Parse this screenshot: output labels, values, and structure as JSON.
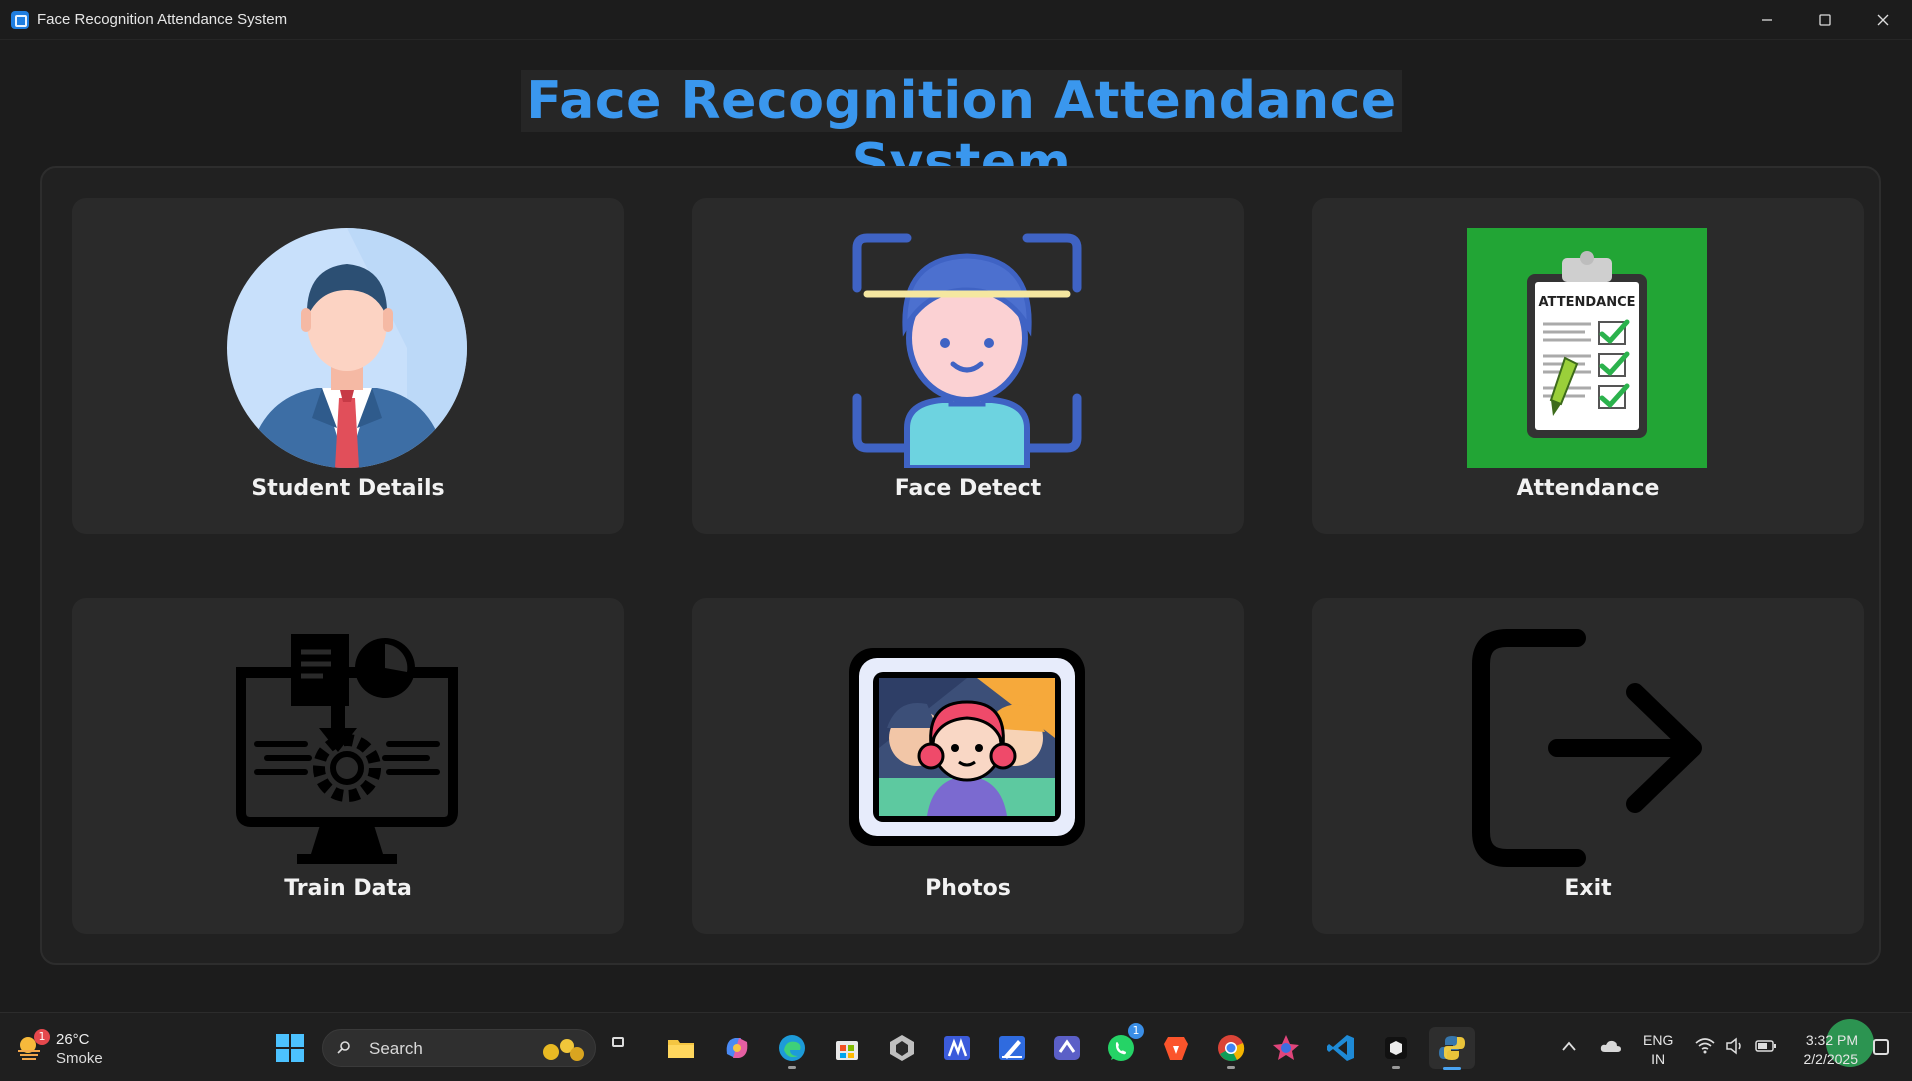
{
  "window": {
    "title": "Face Recognition Attendance System",
    "controls": [
      "minimize",
      "maximize",
      "close"
    ]
  },
  "heading": "Face Recognition Attendance System",
  "colors": {
    "heading": "#3a97ee",
    "background": "#1c1c1c",
    "card": "#2a2a2a",
    "attendance_tile": "#22a535"
  },
  "cards": [
    {
      "label": "Student Details",
      "icon": "student-avatar-icon"
    },
    {
      "label": "Face Detect",
      "icon": "face-scan-icon"
    },
    {
      "label": "Attendance",
      "icon": "attendance-clipboard-icon"
    },
    {
      "label": "Train Data",
      "icon": "train-data-monitor-icon"
    },
    {
      "label": "Photos",
      "icon": "photo-frame-icon"
    },
    {
      "label": "Exit",
      "icon": "exit-arrow-icon"
    }
  ],
  "taskbar": {
    "weather": {
      "temp": "26°C",
      "condition": "Smoke",
      "badge": "1"
    },
    "search_placeholder": "Search",
    "apps": [
      "file-explorer",
      "copilot",
      "edge",
      "store",
      "unity",
      "app-m",
      "app-pen",
      "app-linear",
      "whatsapp",
      "brave",
      "chrome",
      "app-star",
      "vscode",
      "app-box",
      "python"
    ],
    "whatsapp_badge": "1",
    "language": {
      "line1": "ENG",
      "line2": "IN"
    },
    "clock": {
      "time": "3:32 PM",
      "date": "2/2/2025"
    }
  }
}
